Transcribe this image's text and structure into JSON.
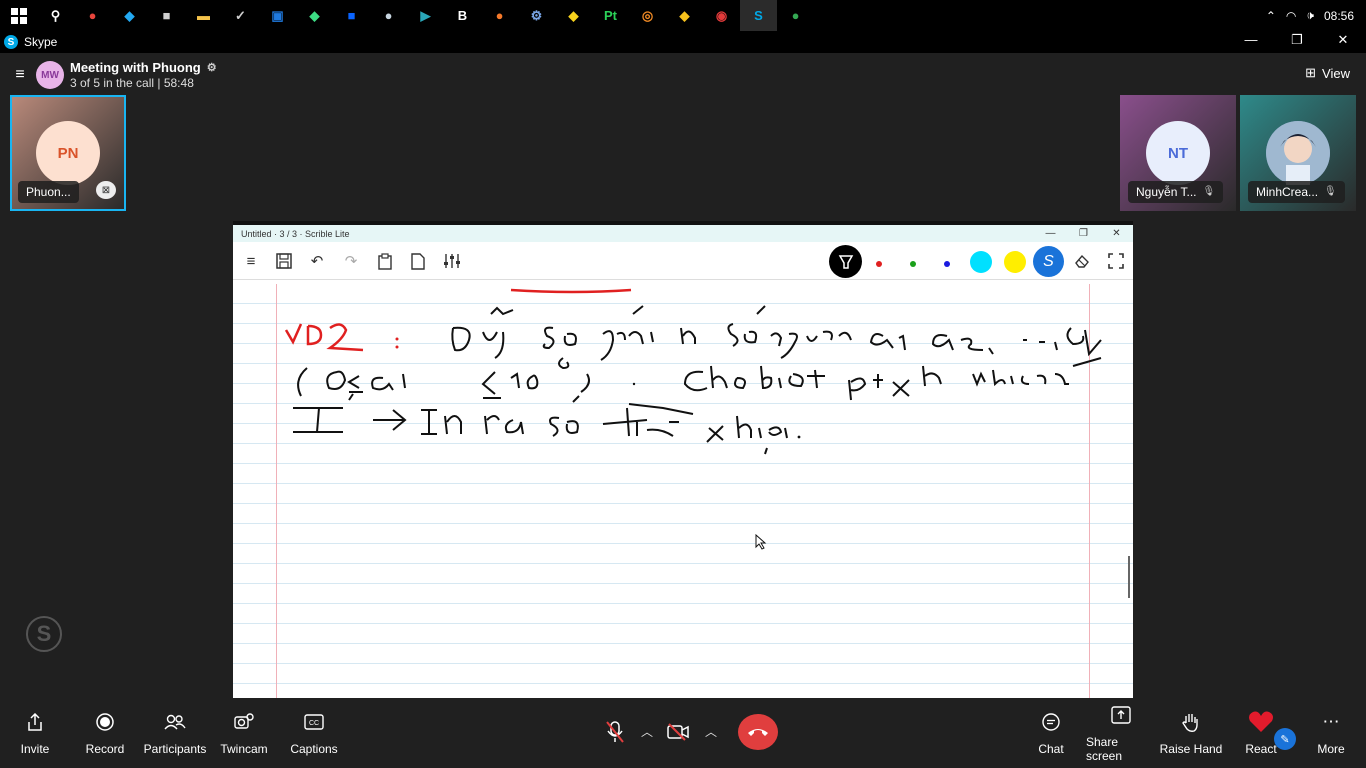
{
  "taskbar": {
    "time": "08:56",
    "apps": [
      {
        "icon": "search-icon",
        "glyph": "⚲",
        "color": "#ffffff"
      },
      {
        "icon": "chrome-icon",
        "glyph": "●",
        "color": "#e8453c"
      },
      {
        "icon": "vscode-icon",
        "glyph": "◆",
        "color": "#23a9f2"
      },
      {
        "icon": "app-icon",
        "glyph": "■",
        "color": "#d0d0d0"
      },
      {
        "icon": "folder-icon",
        "glyph": "▬",
        "color": "#f5c34b"
      },
      {
        "icon": "check-icon",
        "glyph": "✓",
        "color": "#cfcfcf"
      },
      {
        "icon": "store-icon",
        "glyph": "▣",
        "color": "#1f7ae0"
      },
      {
        "icon": "android-icon",
        "glyph": "◆",
        "color": "#3ddc84"
      },
      {
        "icon": "app-blue-icon",
        "glyph": "■",
        "color": "#0a64ff"
      },
      {
        "icon": "steam-icon",
        "glyph": "●",
        "color": "#c7d5e0"
      },
      {
        "icon": "terminal-icon",
        "glyph": "▶",
        "color": "#2aa6b8"
      },
      {
        "icon": "b-icon",
        "glyph": "B",
        "color": "#ffffff"
      },
      {
        "icon": "blender-icon",
        "glyph": "●",
        "color": "#f5792a"
      },
      {
        "icon": "gear-app-icon",
        "glyph": "⚙",
        "color": "#7aa7e8"
      },
      {
        "icon": "sketch-icon",
        "glyph": "◆",
        "color": "#f7d21c"
      },
      {
        "icon": "pt-icon",
        "glyph": "Pt",
        "color": "#2bd158"
      },
      {
        "icon": "search-app-icon",
        "glyph": "◎",
        "color": "#f08a24"
      },
      {
        "icon": "duck-icon",
        "glyph": "◆",
        "color": "#f7c21c"
      },
      {
        "icon": "record-icon",
        "glyph": "◉",
        "color": "#e23a3a"
      },
      {
        "icon": "skype-icon",
        "glyph": "S",
        "color": "#00a8e6",
        "active": true
      },
      {
        "icon": "chrome-icon",
        "glyph": "●",
        "color": "#34a853"
      }
    ]
  },
  "window": {
    "title": "Skype",
    "controls": [
      "—",
      "❐",
      "✕"
    ]
  },
  "meeting": {
    "avatar_initials": "MW",
    "title": "Meeting with Phuong",
    "subtitle": "3 of 5 in the call | 58:48",
    "view_label": "View"
  },
  "participants": [
    {
      "initials": "PN",
      "name": "Phuon...",
      "avatar_bg": "#fde0d0",
      "avatar_color": "#d9532a",
      "tile_bg": "#b8897a"
    },
    {
      "initials": "NT",
      "name": "Nguyễn T...",
      "avatar_bg": "#e8eefc",
      "avatar_color": "#4b6bd8",
      "tile_bg": "#8a4f8c"
    },
    {
      "initials": "",
      "name": "MinhCrea...",
      "avatar_bg": "#5a7ea8",
      "avatar_color": "#ffffff",
      "tile_bg": "#2e8a8a"
    }
  ],
  "scrible": {
    "title": "Untitled · 3 / 3 · Scrible Lite",
    "controls": [
      "—",
      "❐",
      "✕"
    ],
    "colors": [
      "#e02020",
      "#1aa01a",
      "#1a1ae0",
      "#00e0ff",
      "#ffee00"
    ],
    "speed": "1x"
  },
  "controls": {
    "invite": "Invite",
    "record": "Record",
    "participants": "Participants",
    "twincam": "Twincam",
    "captions": "Captions",
    "chat": "Chat",
    "share": "Share screen",
    "raise": "Raise Hand",
    "react": "React",
    "more": "More"
  }
}
